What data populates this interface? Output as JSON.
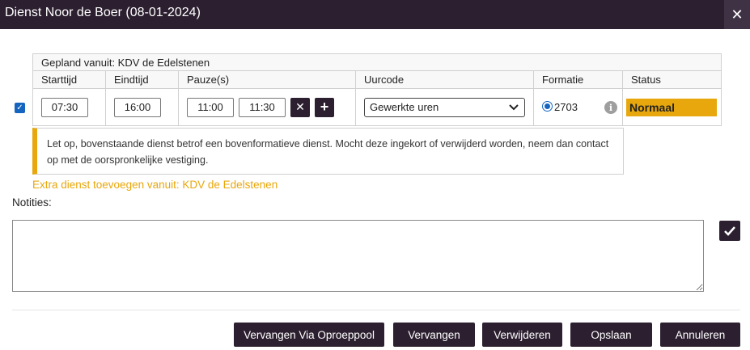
{
  "dialog": {
    "title": "Dienst Noor de Boer (08-01-2024)",
    "close_icon": "close-icon"
  },
  "shift": {
    "planned_from": "Gepland vanuit: KDV de Edelstenen",
    "headers": {
      "start": "Starttijd",
      "end": "Eindtijd",
      "pause": "Pauze(s)",
      "uurcode": "Uurcode",
      "formatie": "Formatie",
      "status": "Status"
    },
    "start_time": "07:30",
    "end_time": "16:00",
    "pause_start": "11:00",
    "pause_end": "11:30",
    "uurcode_selected": "Gewerkte uren",
    "formatie_value": "2703",
    "status": "Normaal",
    "checked": true
  },
  "warning": "Let op, bovenstaande dienst betrof een bovenformatieve dienst. Mocht deze ingekort of verwijderd worden, neem dan contact op met de oorspronkelijke vestiging.",
  "extra_link": "Extra dienst toevoegen vanuit: KDV de Edelstenen",
  "notes": {
    "label": "Notities:",
    "value": ""
  },
  "buttons": {
    "replace_pool": "Vervangen Via Oproeppool",
    "replace": "Vervangen",
    "delete": "Verwijderen",
    "save": "Opslaan",
    "cancel": "Annuleren"
  },
  "colors": {
    "titlebar": "#2c2030",
    "accent": "#e8a70c",
    "checkbox": "#1565c0"
  }
}
